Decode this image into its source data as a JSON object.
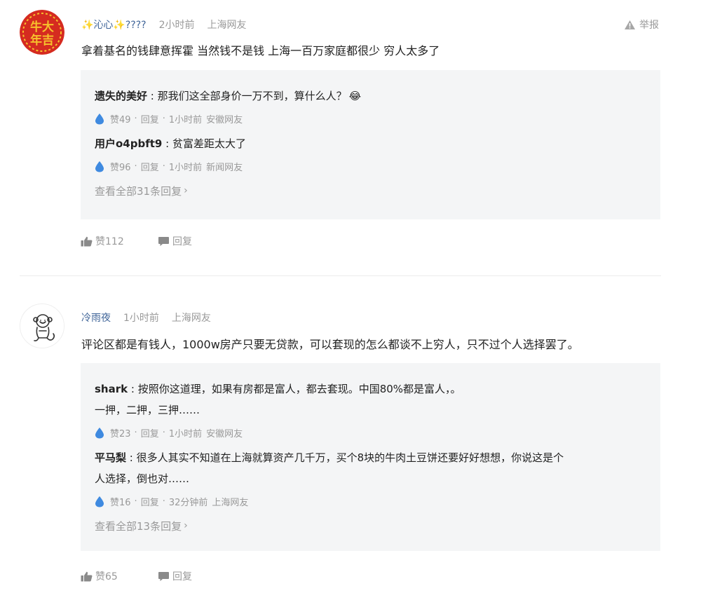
{
  "comments": [
    {
      "user": "✨沁心✨????",
      "time": "2小时前",
      "location": "上海网友",
      "report_label": "举报",
      "text": "拿着基名的钱肆意挥霍 当然钱不是钱 上海一百万家庭都很少 穷人太多了",
      "avatar_text": "牛大年吉",
      "replies": [
        {
          "name": "遗失的美好",
          "text": "那我们这全部身价一万不到，算什么人？",
          "emoji": "😂",
          "likes": "赞49",
          "reply_label": "回复",
          "time": "1小时前",
          "location": "安徽网友"
        },
        {
          "name": "用户o4pbft9",
          "text": "贫富差距太大了",
          "likes": "赞96",
          "reply_label": "回复",
          "time": "1小时前",
          "location": "新闻网友"
        }
      ],
      "view_all": "查看全部31条回复",
      "likes": "赞112",
      "reply_label": "回复"
    },
    {
      "user": "冷雨夜",
      "time": "1小时前",
      "location": "上海网友",
      "text": "评论区都是有钱人，1000w房产只要无贷款，可以套现的怎么都谈不上穷人，只不过个人选择罢了。",
      "replies": [
        {
          "name": "shark",
          "line1": "按照你这道理，如果有房都是富人，都去套现。中国80%都是富人，。",
          "line2": "一押，二押，三押……",
          "likes": "赞23",
          "reply_label": "回复",
          "time": "1小时前",
          "location": "安徽网友"
        },
        {
          "name": "平马梨",
          "line1": "很多人其实不知道在上海就算资产几千万，买个8块的牛肉土豆饼还要好好想想，你说这是个",
          "line2": "人选择，倒也对……",
          "likes": "赞16",
          "reply_label": "回复",
          "time": "32分钟前",
          "location": "上海网友"
        }
      ],
      "view_all": "查看全部13条回复",
      "likes": "赞65",
      "reply_label": "回复"
    }
  ],
  "colors": {
    "username": "#406599",
    "muted": "#999999",
    "reply_bg": "#f4f5f6",
    "avatar_red": "#d52b20",
    "avatar_gold": "#f6c12c",
    "like_drop": "#3f8ae0"
  },
  "icons": [
    "warning-icon",
    "water-drop-icon",
    "thumbs-up-icon",
    "comment-bubble-icon",
    "chevron-right-icon",
    "monkey-avatar-icon"
  ]
}
